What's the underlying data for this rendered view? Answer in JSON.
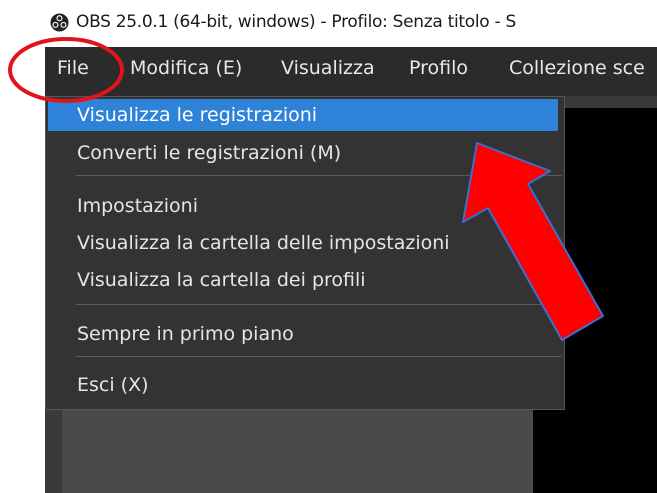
{
  "window": {
    "title": "OBS 25.0.1 (64-bit, windows) - Profilo: Senza titolo - S"
  },
  "menubar": {
    "items": [
      "File",
      "Modifica (E)",
      "Visualizza",
      "Profilo",
      "Collezione sce"
    ]
  },
  "file_menu": {
    "items": [
      {
        "label": "Visualizza le registrazioni",
        "selected": true
      },
      {
        "label": "Converti le registrazioni (M)"
      },
      {
        "label": "Impostazioni"
      },
      {
        "label": "Visualizza la cartella delle impostazioni"
      },
      {
        "label": "Visualizza la cartella dei profili"
      },
      {
        "label": "Sempre in primo piano"
      },
      {
        "label": "Esci (X)"
      }
    ]
  },
  "annotations": {
    "circle_color": "#e0141b",
    "arrow_color": "#ff0000",
    "arrow_outline": "#3a6fd0"
  },
  "colors": {
    "menu_bg": "#2b2b2b",
    "dropdown_bg": "#333333",
    "highlight": "#2e83d9"
  }
}
